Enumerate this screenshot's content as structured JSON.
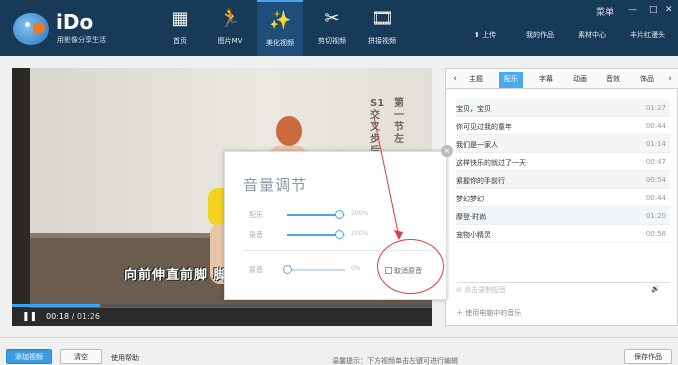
{
  "brand": {
    "name": "iDo",
    "tagline": "用影像分享生活"
  },
  "nav": [
    {
      "label": "首页",
      "icon": "grid-icon",
      "glyph": "▦"
    },
    {
      "label": "图片MV",
      "icon": "runner-icon",
      "glyph": "🏃"
    },
    {
      "label": "美化视频",
      "icon": "magic-wand-icon",
      "glyph": "✨",
      "active": true
    },
    {
      "label": "剪切视频",
      "icon": "scissors-icon",
      "glyph": "✂"
    },
    {
      "label": "拼接视频",
      "icon": "film-icon",
      "glyph": "🎞"
    }
  ],
  "window": {
    "menu": "菜单",
    "minimize": "—",
    "maximize": "□",
    "close": "✕"
  },
  "top_links": {
    "upload": "上传",
    "my_works": "我的作品",
    "materials": "素材中心",
    "clip_bear": "丰片红漫头"
  },
  "video": {
    "caption_vertical_1": "S1 交叉步后搓",
    "caption_vertical_2": "第一节 左",
    "subtitle": "向前伸直前脚 脚",
    "time_current": "00:18",
    "time_total": "01:26",
    "progress": 0.21
  },
  "volume_dialog": {
    "title": "音量调节",
    "music_label": "配乐",
    "music_value": "200%",
    "music_level": 0.9,
    "voice_label": "录音",
    "voice_value": "200%",
    "voice_level": 0.9,
    "original_label": "原音",
    "original_value": "0%",
    "original_level": 0.0,
    "mute_label": "取消原音",
    "close": "×"
  },
  "panel": {
    "tabs": [
      "主题",
      "配乐",
      "字幕",
      "动画",
      "音效",
      "饰品"
    ],
    "active_tab": 1,
    "tracks": [
      {
        "name": "宝贝，宝贝",
        "duration": "01:27"
      },
      {
        "name": "你可见过我的童年",
        "duration": "00:44"
      },
      {
        "name": "我们是一家人",
        "duration": "01:14"
      },
      {
        "name": "这样快乐的就过了一天",
        "duration": "00:47"
      },
      {
        "name": "紧握你的手前行",
        "duration": "00:54"
      },
      {
        "name": "梦幻梦幻",
        "duration": "00:44"
      },
      {
        "name": "摩登·时尚",
        "duration": "01:20"
      },
      {
        "name": "宠物小精灵",
        "duration": "00:58"
      }
    ],
    "voice_placeholder": "点击录制配音",
    "add_music": "使用电脑中的音乐"
  },
  "bottom": {
    "add_video": "添加视频",
    "clear": "清空",
    "help": "使用帮助",
    "hint": "温馨提示：下方视频单击左键可进行编辑",
    "save": "保存作品"
  }
}
